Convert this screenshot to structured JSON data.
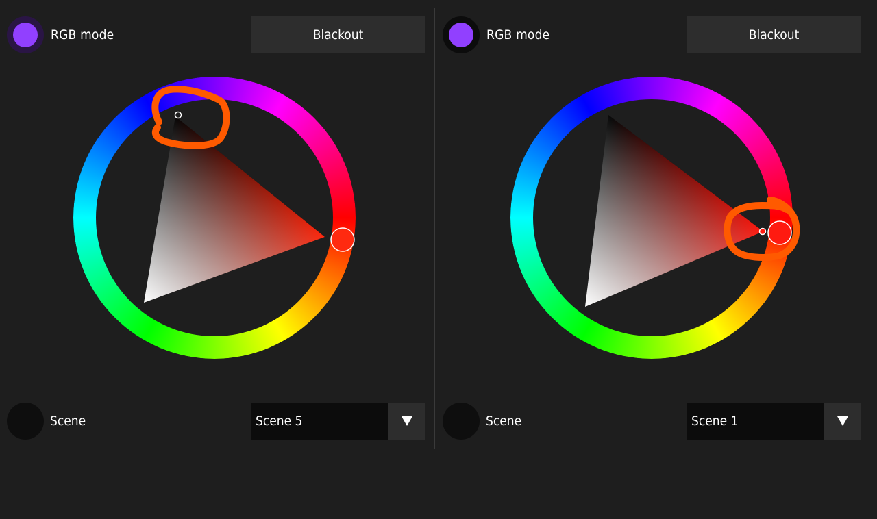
{
  "colors": {
    "background": "#1e1e1e",
    "accent_purple": "#9140ff",
    "annotation_orange": "#ff5a00",
    "button_bg": "#2d2d2d",
    "select_bg": "#0c0c0c"
  },
  "panels": [
    {
      "mode": {
        "label": "RGB mode",
        "icon": "purple-dot-icon",
        "ring_color": "#2a1545"
      },
      "blackout": {
        "label": "Blackout"
      },
      "color_picker": {
        "hue_deg": 10,
        "ring_colors": [
          "red",
          "orange",
          "yellow",
          "green",
          "cyan",
          "blue",
          "magenta"
        ]
      },
      "scene": {
        "label": "Scene",
        "selected": "Scene 5"
      }
    },
    {
      "mode": {
        "label": "RGB mode",
        "icon": "purple-dot-icon",
        "ring_color": "#0c0c0c"
      },
      "blackout": {
        "label": "Blackout"
      },
      "color_picker": {
        "hue_deg": 4,
        "ring_colors": [
          "red",
          "orange",
          "yellow",
          "green",
          "cyan",
          "blue",
          "magenta"
        ]
      },
      "scene": {
        "label": "Scene",
        "selected": "Scene 1"
      }
    }
  ]
}
